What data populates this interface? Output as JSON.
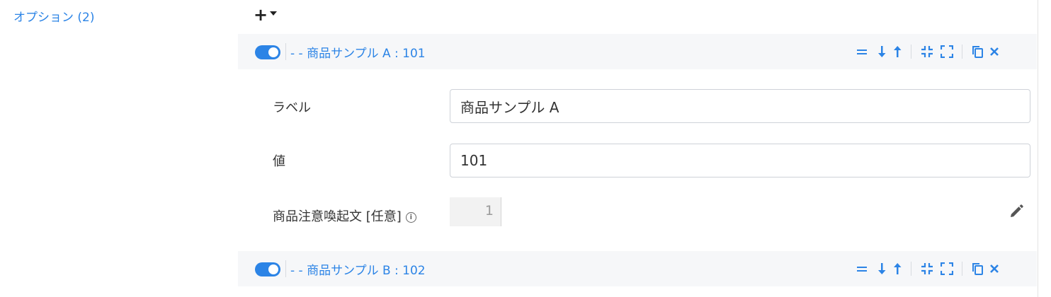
{
  "section": {
    "label": "オプション (2)"
  },
  "add_button": {
    "plus": "+",
    "icon": "plus-dropdown-icon"
  },
  "options": [
    {
      "enabled": true,
      "title": "- - 商品サンプル A : 101"
    },
    {
      "enabled": true,
      "title": "- - 商品サンプル B : 102"
    }
  ],
  "toolbar_icons": [
    "reorder-icon",
    "move-down-icon",
    "move-up-icon",
    "collapse-icon",
    "expand-icon",
    "copy-icon",
    "close-icon"
  ],
  "form": {
    "label_field": {
      "label": "ラベル",
      "value": "商品サンプル A"
    },
    "value_field": {
      "label": "値",
      "value": "101"
    },
    "notice_field": {
      "label": "商品注意喚起文 [任意]",
      "info": "i",
      "line_number": "1",
      "edit_icon": "pencil-icon"
    }
  },
  "colors": {
    "accent": "#2c84e6",
    "header_bg": "#f6f7f9",
    "border": "#ced2d8"
  }
}
